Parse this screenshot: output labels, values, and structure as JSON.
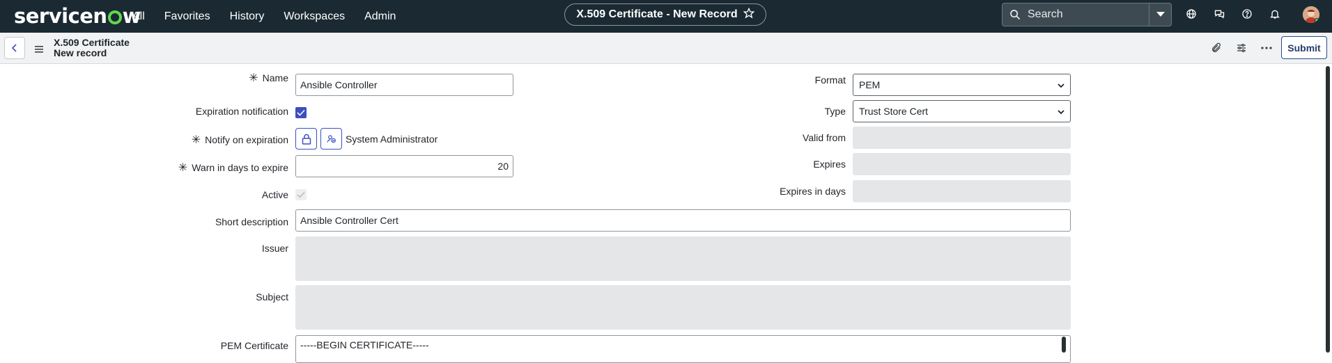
{
  "brand": {
    "logo_text": "servicenow",
    "accent": "#62d84e"
  },
  "nav": {
    "links": [
      "All",
      "Favorites",
      "History",
      "Workspaces",
      "Admin"
    ],
    "record_title": "X.509 Certificate - New Record",
    "search_placeholder": "Search",
    "icons": [
      "globe-icon",
      "chat-icon",
      "help-icon",
      "bell-icon"
    ]
  },
  "header": {
    "title_line1": "X.509 Certificate",
    "title_line2": "New record",
    "submit_label": "Submit",
    "icons": [
      "paperclip-icon",
      "settings-sliders-icon",
      "more-icon"
    ]
  },
  "form": {
    "name": {
      "label": "Name",
      "value": "Ansible Controller",
      "mandatory": true
    },
    "expiration_notification": {
      "label": "Expiration notification",
      "checked": true
    },
    "notify_on_expiration": {
      "label": "Notify on expiration",
      "value": "System Administrator",
      "mandatory": true
    },
    "warn_days": {
      "label": "Warn in days to expire",
      "value": "20",
      "mandatory": true
    },
    "active": {
      "label": "Active",
      "checked": true,
      "disabled": true
    },
    "short_description": {
      "label": "Short description",
      "value": "Ansible Controller Cert"
    },
    "issuer": {
      "label": "Issuer",
      "value": ""
    },
    "subject": {
      "label": "Subject",
      "value": ""
    },
    "pem_certificate": {
      "label": "PEM Certificate",
      "value": "-----BEGIN CERTIFICATE-----"
    },
    "format": {
      "label": "Format",
      "value": "PEM"
    },
    "type": {
      "label": "Type",
      "value": "Trust Store Cert"
    },
    "valid_from": {
      "label": "Valid from",
      "value": ""
    },
    "expires": {
      "label": "Expires",
      "value": ""
    },
    "expires_in_days": {
      "label": "Expires in days",
      "value": ""
    }
  }
}
